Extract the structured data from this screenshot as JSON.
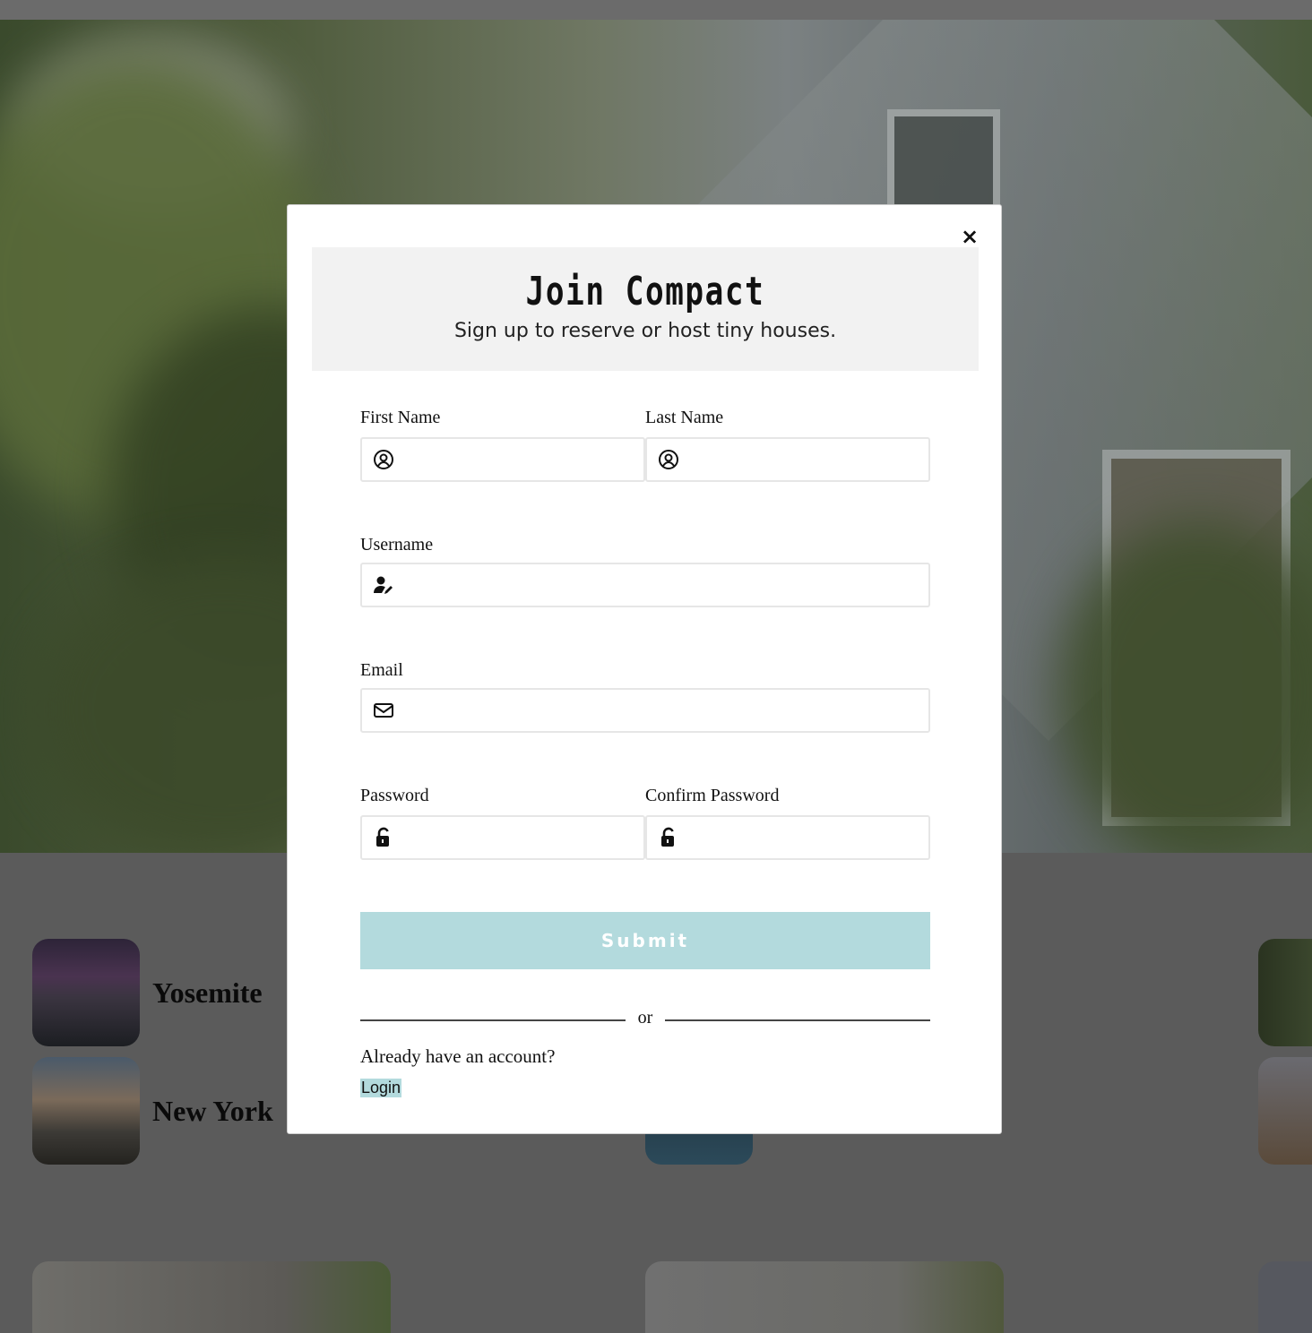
{
  "modal": {
    "title": "Join Compact",
    "subtitle": "Sign up to reserve or host tiny houses.",
    "close_label": "×",
    "fields": {
      "first_name": {
        "label": "First Name",
        "icon": "user-circle-icon",
        "value": ""
      },
      "last_name": {
        "label": "Last Name",
        "icon": "user-circle-icon",
        "value": ""
      },
      "username": {
        "label": "Username",
        "icon": "user-edit-icon",
        "value": ""
      },
      "email": {
        "label": "Email",
        "icon": "envelope-icon",
        "value": ""
      },
      "password": {
        "label": "Password",
        "icon": "unlock-icon",
        "value": ""
      },
      "confirm_password": {
        "label": "Confirm Password",
        "icon": "unlock-icon",
        "value": ""
      }
    },
    "submit_label": "Submit",
    "divider_text": "or",
    "already_text": "Already have an account?",
    "login_label": "Login"
  },
  "background": {
    "destinations": [
      {
        "name": "Yosemite"
      },
      {
        "name": "New York"
      }
    ]
  },
  "colors": {
    "accent": "#b3dadd",
    "overlay": "#5b5b5b",
    "header_bg": "#f2f2f2"
  }
}
